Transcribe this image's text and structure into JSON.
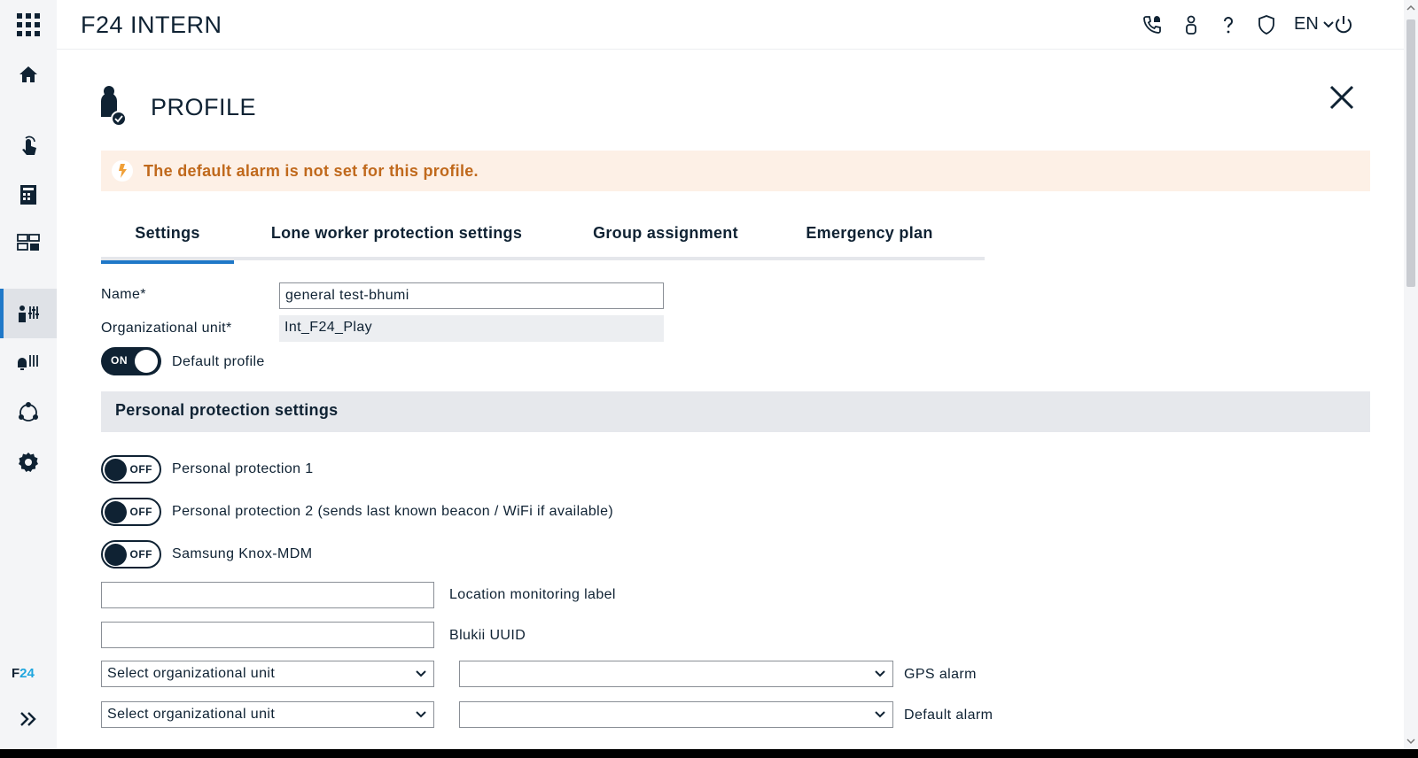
{
  "header": {
    "app_title": "F24 INTERN",
    "language": "EN"
  },
  "sidebar": {
    "logo_f": "F",
    "logo_num": "24",
    "items": [
      {
        "icon": "home-icon"
      },
      {
        "icon": "touch-alarm-icon"
      },
      {
        "icon": "building-icon"
      },
      {
        "icon": "dashboard-icon"
      },
      {
        "icon": "profile-settings-icon",
        "active": true
      },
      {
        "icon": "alarm-settings-icon"
      },
      {
        "icon": "network-icon"
      },
      {
        "icon": "gear-icon"
      }
    ]
  },
  "page": {
    "title": "PROFILE",
    "alert": "The default alarm is not set for this profile."
  },
  "tabs": [
    {
      "label": "Settings",
      "active": true
    },
    {
      "label": "Lone worker protection settings"
    },
    {
      "label": "Group assignment"
    },
    {
      "label": "Emergency plan"
    }
  ],
  "form": {
    "name_label": "Name*",
    "name_value": "general test-bhumi",
    "org_unit_label": "Organizational unit*",
    "org_unit_value": "Int_F24_Play",
    "default_profile_label": "Default profile",
    "default_profile_state": "ON"
  },
  "personal_protection": {
    "section_title": "Personal protection settings",
    "toggles": [
      {
        "label": "Personal protection 1",
        "state": "OFF"
      },
      {
        "label": "Personal protection 2 (sends last known beacon / WiFi if available)",
        "state": "OFF"
      },
      {
        "label": "Samsung Knox-MDM",
        "state": "OFF"
      }
    ],
    "location_monitoring_label": "Location monitoring label",
    "blukii_uuid_label": "Blukii UUID",
    "gps_org_unit_placeholder": "Select organizational unit",
    "gps_alarm_label": "GPS alarm",
    "default_org_unit_placeholder": "Select organizational unit",
    "default_alarm_label": "Default alarm"
  },
  "colors": {
    "accent": "#1f78c8",
    "dark": "#0f2233",
    "warning_bg": "#fdf0e6",
    "warning_text": "#c0691c"
  }
}
